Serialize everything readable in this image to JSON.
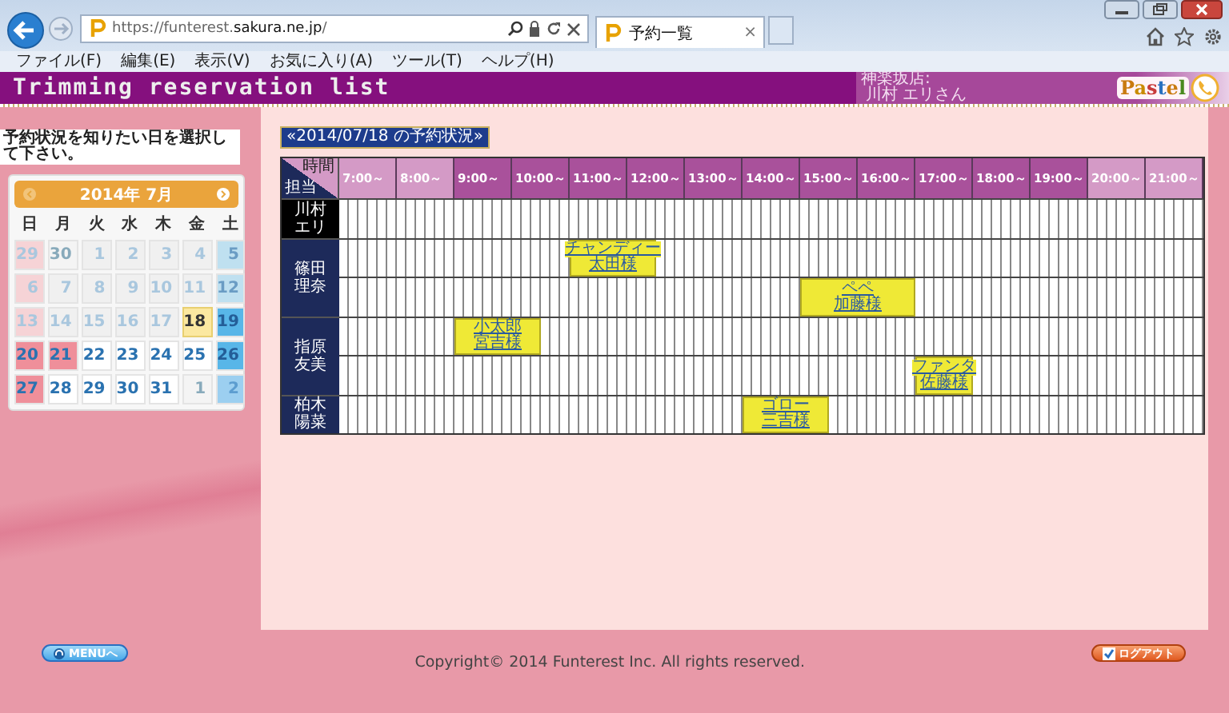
{
  "browser": {
    "url_host": "https://funterest.",
    "url_domain": "sakura.ne.jp",
    "url_path": "/",
    "tab_title": "予約一覧",
    "tab_close": "×",
    "menu": [
      "ファイル(F)",
      "編集(E)",
      "表示(V)",
      "お気に入り(A)",
      "ツール(T)",
      "ヘルプ(H)"
    ]
  },
  "header": {
    "title": "Trimming reservation list",
    "store": "神楽坂店:",
    "user": "川村 エリさん",
    "logo": "Pastel"
  },
  "sidebar": {
    "instruction": "予約状況を知りたい日を選択して下さい。",
    "calendar": {
      "month": "2014年 7月",
      "weekdays": [
        "日",
        "月",
        "火",
        "水",
        "木",
        "金",
        "土"
      ],
      "weeks": [
        [
          {
            "label": "29",
            "kind": "sun",
            "past": true,
            "other_month": true,
            "selected": false
          },
          {
            "label": "30",
            "kind": "weekday",
            "past": true,
            "other_month": true,
            "selected": false
          },
          {
            "label": "1",
            "kind": "weekday",
            "past": true,
            "other_month": false,
            "selected": false
          },
          {
            "label": "2",
            "kind": "weekday",
            "past": true,
            "other_month": false,
            "selected": false
          },
          {
            "label": "3",
            "kind": "weekday",
            "past": true,
            "other_month": false,
            "selected": false
          },
          {
            "label": "4",
            "kind": "weekday",
            "past": true,
            "other_month": false,
            "selected": false
          },
          {
            "label": "5",
            "kind": "sat",
            "past": true,
            "other_month": false,
            "selected": false
          }
        ],
        [
          {
            "label": "6",
            "kind": "sun",
            "past": true,
            "other_month": false,
            "selected": false
          },
          {
            "label": "7",
            "kind": "weekday",
            "past": true,
            "other_month": false,
            "selected": false
          },
          {
            "label": "8",
            "kind": "weekday",
            "past": true,
            "other_month": false,
            "selected": false
          },
          {
            "label": "9",
            "kind": "weekday",
            "past": true,
            "other_month": false,
            "selected": false
          },
          {
            "label": "10",
            "kind": "weekday",
            "past": true,
            "other_month": false,
            "selected": false
          },
          {
            "label": "11",
            "kind": "weekday",
            "past": true,
            "other_month": false,
            "selected": false
          },
          {
            "label": "12",
            "kind": "sat",
            "past": true,
            "other_month": false,
            "selected": false
          }
        ],
        [
          {
            "label": "13",
            "kind": "sun",
            "past": true,
            "other_month": false,
            "selected": false
          },
          {
            "label": "14",
            "kind": "weekday",
            "past": true,
            "other_month": false,
            "selected": false
          },
          {
            "label": "15",
            "kind": "weekday",
            "past": true,
            "other_month": false,
            "selected": false
          },
          {
            "label": "16",
            "kind": "weekday",
            "past": true,
            "other_month": false,
            "selected": false
          },
          {
            "label": "17",
            "kind": "weekday",
            "past": true,
            "other_month": false,
            "selected": false
          },
          {
            "label": "18",
            "kind": "weekday",
            "past": false,
            "other_month": false,
            "selected": true
          },
          {
            "label": "19",
            "kind": "sat",
            "past": false,
            "other_month": false,
            "selected": false
          }
        ],
        [
          {
            "label": "20",
            "kind": "sun",
            "past": false,
            "other_month": false,
            "selected": false
          },
          {
            "label": "21",
            "kind": "holiday",
            "past": false,
            "other_month": false,
            "selected": false
          },
          {
            "label": "22",
            "kind": "weekday",
            "past": false,
            "other_month": false,
            "selected": false
          },
          {
            "label": "23",
            "kind": "weekday",
            "past": false,
            "other_month": false,
            "selected": false
          },
          {
            "label": "24",
            "kind": "weekday",
            "past": false,
            "other_month": false,
            "selected": false
          },
          {
            "label": "25",
            "kind": "weekday",
            "past": false,
            "other_month": false,
            "selected": false
          },
          {
            "label": "26",
            "kind": "sat",
            "past": false,
            "other_month": false,
            "selected": false
          }
        ],
        [
          {
            "label": "27",
            "kind": "sun",
            "past": false,
            "other_month": false,
            "selected": false
          },
          {
            "label": "28",
            "kind": "weekday",
            "past": false,
            "other_month": false,
            "selected": false
          },
          {
            "label": "29",
            "kind": "weekday",
            "past": false,
            "other_month": false,
            "selected": false
          },
          {
            "label": "30",
            "kind": "weekday",
            "past": false,
            "other_month": false,
            "selected": false
          },
          {
            "label": "31",
            "kind": "weekday",
            "past": false,
            "other_month": false,
            "selected": false
          },
          {
            "label": "1",
            "kind": "weekday",
            "past": false,
            "other_month": true,
            "selected": false
          },
          {
            "label": "2",
            "kind": "sat",
            "past": false,
            "other_month": true,
            "selected": false
          }
        ]
      ]
    }
  },
  "schedule": {
    "date_title": "«2014/07/18  の予約状況»",
    "corner_top": "時間",
    "corner_bottom": "担当",
    "hours": [
      {
        "label": "7:00～",
        "open": false
      },
      {
        "label": "8:00～",
        "open": false
      },
      {
        "label": "9:00～",
        "open": true
      },
      {
        "label": "10:00～",
        "open": true
      },
      {
        "label": "11:00～",
        "open": true
      },
      {
        "label": "12:00～",
        "open": true
      },
      {
        "label": "13:00～",
        "open": true
      },
      {
        "label": "14:00～",
        "open": true
      },
      {
        "label": "15:00～",
        "open": true
      },
      {
        "label": "16:00～",
        "open": true
      },
      {
        "label": "17:00～",
        "open": true
      },
      {
        "label": "18:00～",
        "open": true
      },
      {
        "label": "19:00～",
        "open": true
      },
      {
        "label": "20:00～",
        "open": false
      },
      {
        "label": "21:00～",
        "open": false
      }
    ],
    "staff": [
      {
        "name": "川村エリ",
        "current_user": true,
        "rows": [
          [
            {
              "kind": "free"
            },
            {
              "kind": "free"
            },
            {
              "kind": "free"
            },
            {
              "kind": "free"
            },
            {
              "kind": "free"
            },
            {
              "kind": "free"
            },
            {
              "kind": "free"
            },
            {
              "kind": "free"
            },
            {
              "kind": "free"
            },
            {
              "kind": "free"
            },
            {
              "kind": "free"
            },
            {
              "kind": "free"
            },
            {
              "kind": "free"
            },
            {
              "kind": "free"
            },
            {
              "kind": "free"
            },
            {
              "kind": "free"
            },
            {
              "kind": "free"
            },
            {
              "kind": "free"
            },
            {
              "kind": "free"
            },
            {
              "kind": "free"
            },
            {
              "kind": "free"
            },
            {
              "kind": "free"
            },
            {
              "kind": "free"
            },
            {
              "kind": "free"
            },
            {
              "kind": "free"
            },
            {
              "kind": "free"
            },
            {
              "kind": "free"
            },
            {
              "kind": "free"
            },
            {
              "kind": "free"
            },
            {
              "kind": "free"
            }
          ]
        ]
      },
      {
        "name": "篠田理奈",
        "current_user": false,
        "rows": [
          [
            {
              "kind": "free"
            },
            {
              "kind": "free"
            },
            {
              "kind": "free"
            },
            {
              "kind": "free"
            },
            {
              "kind": "free"
            },
            {
              "kind": "free"
            },
            {
              "kind": "free"
            },
            {
              "kind": "free"
            },
            {
              "kind": "booking",
              "pet": "チャンディー",
              "owner": "太田様"
            },
            {
              "kind": "continued"
            },
            {
              "kind": "continued"
            },
            {
              "kind": "free"
            },
            {
              "kind": "free"
            },
            {
              "kind": "free"
            },
            {
              "kind": "free"
            },
            {
              "kind": "free"
            },
            {
              "kind": "free"
            },
            {
              "kind": "free"
            },
            {
              "kind": "free"
            },
            {
              "kind": "free"
            },
            {
              "kind": "free"
            },
            {
              "kind": "free"
            },
            {
              "kind": "free"
            },
            {
              "kind": "free"
            },
            {
              "kind": "free"
            },
            {
              "kind": "free"
            },
            {
              "kind": "free"
            },
            {
              "kind": "free"
            },
            {
              "kind": "free"
            },
            {
              "kind": "free"
            }
          ],
          [
            {
              "kind": "free"
            },
            {
              "kind": "free"
            },
            {
              "kind": "free"
            },
            {
              "kind": "free"
            },
            {
              "kind": "free"
            },
            {
              "kind": "free"
            },
            {
              "kind": "free"
            },
            {
              "kind": "free"
            },
            {
              "kind": "free"
            },
            {
              "kind": "free"
            },
            {
              "kind": "free"
            },
            {
              "kind": "free"
            },
            {
              "kind": "free"
            },
            {
              "kind": "free"
            },
            {
              "kind": "free"
            },
            {
              "kind": "free"
            },
            {
              "kind": "booking",
              "pet": "ペペ",
              "owner": "加藤様"
            },
            {
              "kind": "continued"
            },
            {
              "kind": "continued"
            },
            {
              "kind": "continued"
            },
            {
              "kind": "free"
            },
            {
              "kind": "free"
            },
            {
              "kind": "free"
            },
            {
              "kind": "free"
            },
            {
              "kind": "free"
            },
            {
              "kind": "free"
            },
            {
              "kind": "free"
            },
            {
              "kind": "free"
            },
            {
              "kind": "free"
            },
            {
              "kind": "free"
            }
          ]
        ]
      },
      {
        "name": "指原友美",
        "current_user": false,
        "rows": [
          [
            {
              "kind": "free"
            },
            {
              "kind": "free"
            },
            {
              "kind": "free"
            },
            {
              "kind": "free"
            },
            {
              "kind": "booking",
              "pet": "小太郎",
              "owner": "宮吉様"
            },
            {
              "kind": "continued"
            },
            {
              "kind": "continued"
            },
            {
              "kind": "free"
            },
            {
              "kind": "free"
            },
            {
              "kind": "free"
            },
            {
              "kind": "free"
            },
            {
              "kind": "free"
            },
            {
              "kind": "free"
            },
            {
              "kind": "free"
            },
            {
              "kind": "free"
            },
            {
              "kind": "free"
            },
            {
              "kind": "free"
            },
            {
              "kind": "free"
            },
            {
              "kind": "free"
            },
            {
              "kind": "free"
            },
            {
              "kind": "free"
            },
            {
              "kind": "free"
            },
            {
              "kind": "free"
            },
            {
              "kind": "free"
            },
            {
              "kind": "free"
            },
            {
              "kind": "free"
            },
            {
              "kind": "free"
            },
            {
              "kind": "free"
            },
            {
              "kind": "free"
            },
            {
              "kind": "free"
            }
          ],
          [
            {
              "kind": "free"
            },
            {
              "kind": "free"
            },
            {
              "kind": "free"
            },
            {
              "kind": "free"
            },
            {
              "kind": "free"
            },
            {
              "kind": "free"
            },
            {
              "kind": "free"
            },
            {
              "kind": "free"
            },
            {
              "kind": "free"
            },
            {
              "kind": "free"
            },
            {
              "kind": "free"
            },
            {
              "kind": "free"
            },
            {
              "kind": "free"
            },
            {
              "kind": "free"
            },
            {
              "kind": "free"
            },
            {
              "kind": "free"
            },
            {
              "kind": "free"
            },
            {
              "kind": "free"
            },
            {
              "kind": "free"
            },
            {
              "kind": "free"
            },
            {
              "kind": "booking",
              "pet": "ファンタ",
              "owner": "佐藤様"
            },
            {
              "kind": "continued"
            },
            {
              "kind": "free"
            },
            {
              "kind": "free"
            },
            {
              "kind": "free"
            },
            {
              "kind": "free"
            },
            {
              "kind": "free"
            },
            {
              "kind": "free"
            },
            {
              "kind": "free"
            },
            {
              "kind": "free"
            }
          ]
        ]
      },
      {
        "name": "柏木陽菜",
        "current_user": false,
        "rows": [
          [
            {
              "kind": "free"
            },
            {
              "kind": "free"
            },
            {
              "kind": "free"
            },
            {
              "kind": "free"
            },
            {
              "kind": "free"
            },
            {
              "kind": "free"
            },
            {
              "kind": "free"
            },
            {
              "kind": "free"
            },
            {
              "kind": "free"
            },
            {
              "kind": "free"
            },
            {
              "kind": "free"
            },
            {
              "kind": "free"
            },
            {
              "kind": "free"
            },
            {
              "kind": "free"
            },
            {
              "kind": "booking",
              "pet": "ゴロー",
              "owner": "三吉様"
            },
            {
              "kind": "continued"
            },
            {
              "kind": "continued"
            },
            {
              "kind": "free"
            },
            {
              "kind": "free"
            },
            {
              "kind": "free"
            },
            {
              "kind": "free"
            },
            {
              "kind": "free"
            },
            {
              "kind": "free"
            },
            {
              "kind": "free"
            },
            {
              "kind": "free"
            },
            {
              "kind": "free"
            },
            {
              "kind": "free"
            },
            {
              "kind": "free"
            },
            {
              "kind": "free"
            },
            {
              "kind": "free"
            }
          ]
        ]
      }
    ]
  },
  "footer": {
    "menu_button": "MENUへ",
    "copyright": "Copyright© 2014 Funterest Inc. All rights reserved.",
    "logout_button": "ログアウト"
  }
}
